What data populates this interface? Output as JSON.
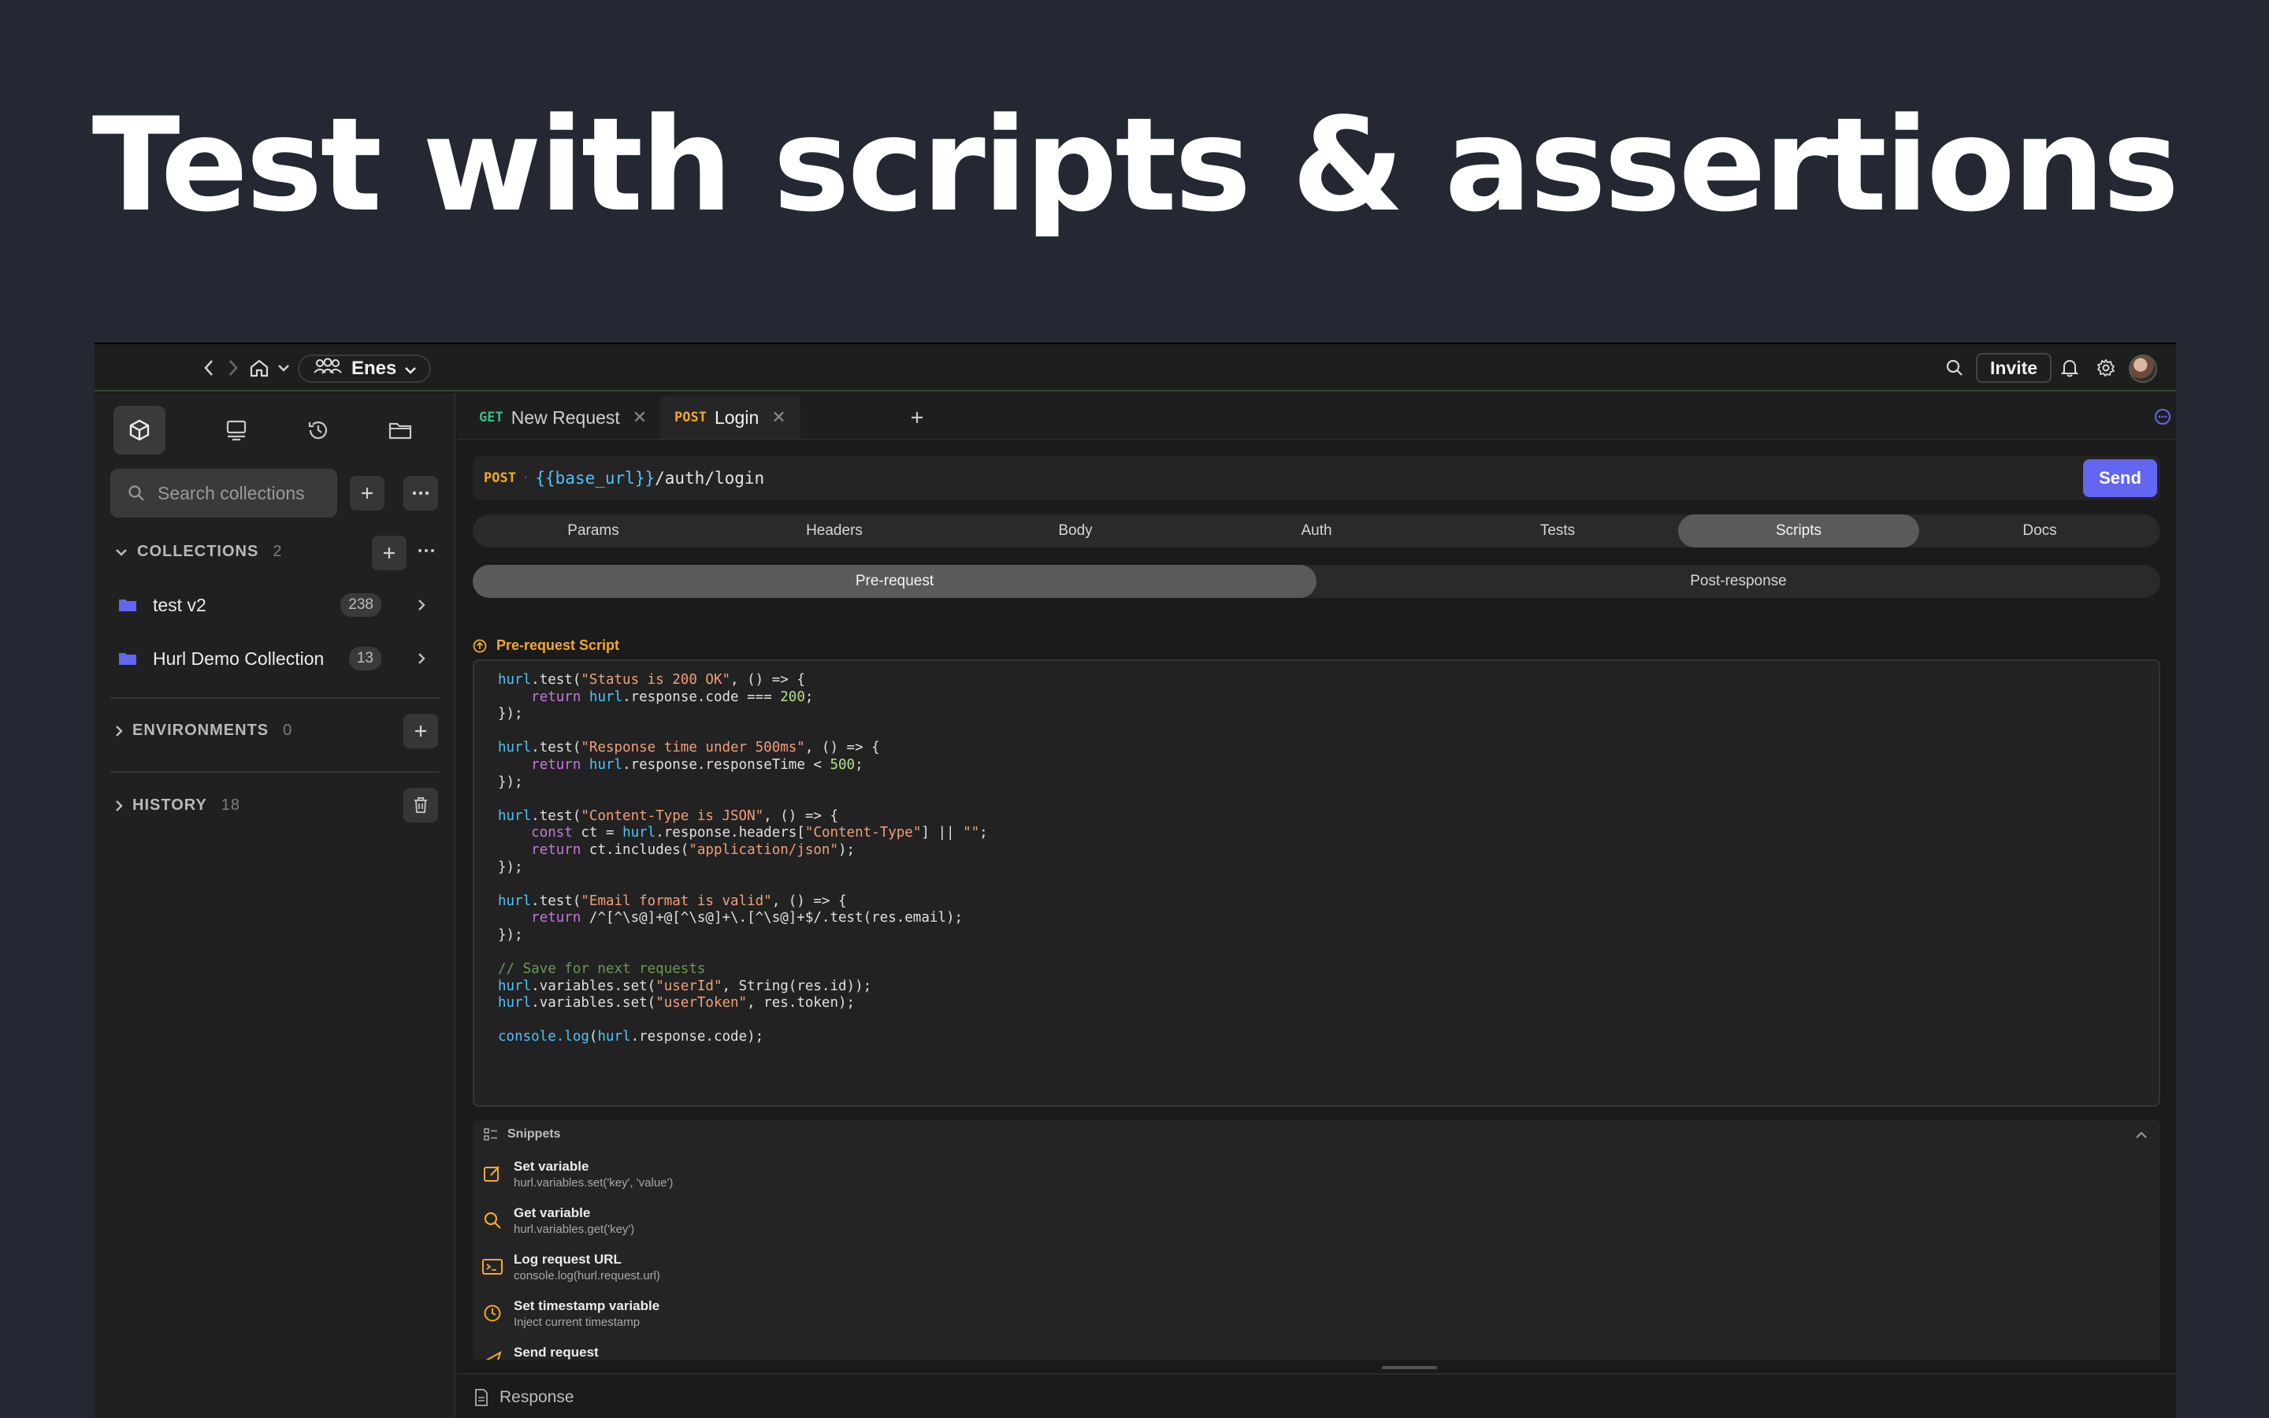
{
  "headline": "Test with scripts & assertions",
  "titlebar": {
    "workspace": "Enes",
    "invite_label": "Invite",
    "icons": [
      "back-icon",
      "forward-icon",
      "home-icon",
      "chevron-down-icon",
      "team-icon",
      "search-icon",
      "bell-icon",
      "gear-icon"
    ]
  },
  "sidebar": {
    "search_placeholder": "Search collections",
    "collections": {
      "title": "COLLECTIONS",
      "count": "2",
      "items": [
        {
          "name": "test v2",
          "count": "238"
        },
        {
          "name": "Hurl Demo Collection",
          "count": "13"
        }
      ]
    },
    "environments": {
      "title": "ENVIRONMENTS",
      "count": "0"
    },
    "history": {
      "title": "HISTORY",
      "count": "18"
    }
  },
  "request_tabs": [
    {
      "method": "GET",
      "name": "New Request"
    },
    {
      "method": "POST",
      "name": "Login"
    }
  ],
  "url_bar": {
    "method": "POST",
    "variable": "{{base_url}}",
    "path": "/auth/login",
    "send_label": "Send"
  },
  "section_tabs": [
    "Params",
    "Headers",
    "Body",
    "Auth",
    "Tests",
    "Scripts",
    "Docs"
  ],
  "active_section": "Scripts",
  "script_tabs": [
    "Pre-request",
    "Post-response"
  ],
  "active_script_tab": "Pre-request",
  "script_label": "Pre-request Script",
  "code_lines": [
    "hurl.test(\"Status is 200 OK\", () => {",
    "    return hurl.response.code === 200;",
    "});",
    "",
    "hurl.test(\"Response time under 500ms\", () => {",
    "    return hurl.response.responseTime < 500;",
    "});",
    "",
    "hurl.test(\"Content-Type is JSON\", () => {",
    "    const ct = hurl.response.headers[\"Content-Type\"] || \"\";",
    "    return ct.includes(\"application/json\");",
    "});",
    "",
    "hurl.test(\"Email format is valid\", () => {",
    "    return /^[^\\s@]+@[^\\s@]+\\.[^\\s@]+$/.test(res.email);",
    "});",
    "",
    "// Save for next requests",
    "hurl.variables.set(\"userId\", String(res.id));",
    "hurl.variables.set(\"userToken\", res.token);",
    "",
    "console.log(hurl.response.code);"
  ],
  "snippets": {
    "title": "Snippets",
    "items": [
      {
        "title": "Set variable",
        "code": "hurl.variables.set('key', 'value')",
        "icon": "edit-icon"
      },
      {
        "title": "Get variable",
        "code": "hurl.variables.get('key')",
        "icon": "search-icon"
      },
      {
        "title": "Log request URL",
        "code": "console.log(hurl.request.url)",
        "icon": "terminal-icon"
      },
      {
        "title": "Set timestamp variable",
        "code": "Inject current timestamp",
        "icon": "clock-icon"
      },
      {
        "title": "Send request",
        "code": "",
        "icon": "send-icon"
      }
    ]
  },
  "response_label": "Response",
  "colors": {
    "accent": "#6366f1",
    "post": "#f2a92c",
    "get": "#3bbf86",
    "variable": "#4fc3f7"
  }
}
